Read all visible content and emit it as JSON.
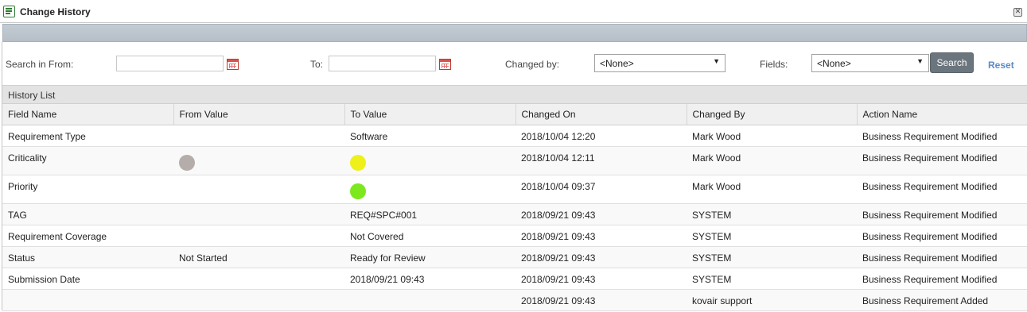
{
  "window": {
    "title": "Change History",
    "close_glyph": "✕"
  },
  "search": {
    "from_label": "Search in From:",
    "from_value": "",
    "to_label": "To:",
    "to_value": "",
    "changed_by_label": "Changed by:",
    "changed_by_value": "<None>",
    "fields_label": "Fields:",
    "fields_value": "<None>",
    "search_button": "Search",
    "reset_link": "Reset"
  },
  "history": {
    "section_title": "History List",
    "columns": [
      "Field Name",
      "From Value",
      "To Value",
      "Changed On",
      "Changed By",
      "Action Name"
    ],
    "rows": [
      {
        "field": "Requirement Type",
        "from": "",
        "to": "Software",
        "changed_on": "2018/10/04 12:20",
        "changed_by": "Mark Wood",
        "action": "Business Requirement Modified"
      },
      {
        "field": "Criticality",
        "from": "",
        "from_color": "#b5adaa",
        "to": "",
        "to_color": "#eef01a",
        "changed_on": "2018/10/04 12:11",
        "changed_by": "Mark Wood",
        "action": "Business Requirement Modified"
      },
      {
        "field": "Priority",
        "from": "",
        "to": "",
        "to_color": "#7ee81e",
        "changed_on": "2018/10/04 09:37",
        "changed_by": "Mark Wood",
        "action": "Business Requirement Modified"
      },
      {
        "field": "TAG",
        "from": "",
        "to": "REQ#SPC#001",
        "changed_on": "2018/09/21 09:43",
        "changed_by": "SYSTEM",
        "action": "Business Requirement Modified"
      },
      {
        "field": "Requirement Coverage",
        "from": "",
        "to": "Not Covered",
        "changed_on": "2018/09/21 09:43",
        "changed_by": "SYSTEM",
        "action": "Business Requirement Modified"
      },
      {
        "field": "Status",
        "from": "Not Started",
        "to": "Ready for Review",
        "changed_on": "2018/09/21 09:43",
        "changed_by": "SYSTEM",
        "action": "Business Requirement Modified"
      },
      {
        "field": "Submission Date",
        "from": "",
        "to": "2018/09/21 09:43",
        "changed_on": "2018/09/21 09:43",
        "changed_by": "SYSTEM",
        "action": "Business Requirement Modified"
      },
      {
        "field": "",
        "from": "",
        "to": "",
        "changed_on": "2018/09/21 09:43",
        "changed_by": "kovair support",
        "action": "Business Requirement Added"
      }
    ]
  },
  "icons": {
    "title_icon": "list-window-icon",
    "close_icon": "close-icon",
    "calendar_icon": "calendar-icon",
    "dropdown_icon": "dropdown-arrow-icon"
  },
  "colors": {
    "search_button_bg": "#6b757d",
    "reset_link": "#5b8cc4",
    "accent_green": "#2e7d32"
  }
}
